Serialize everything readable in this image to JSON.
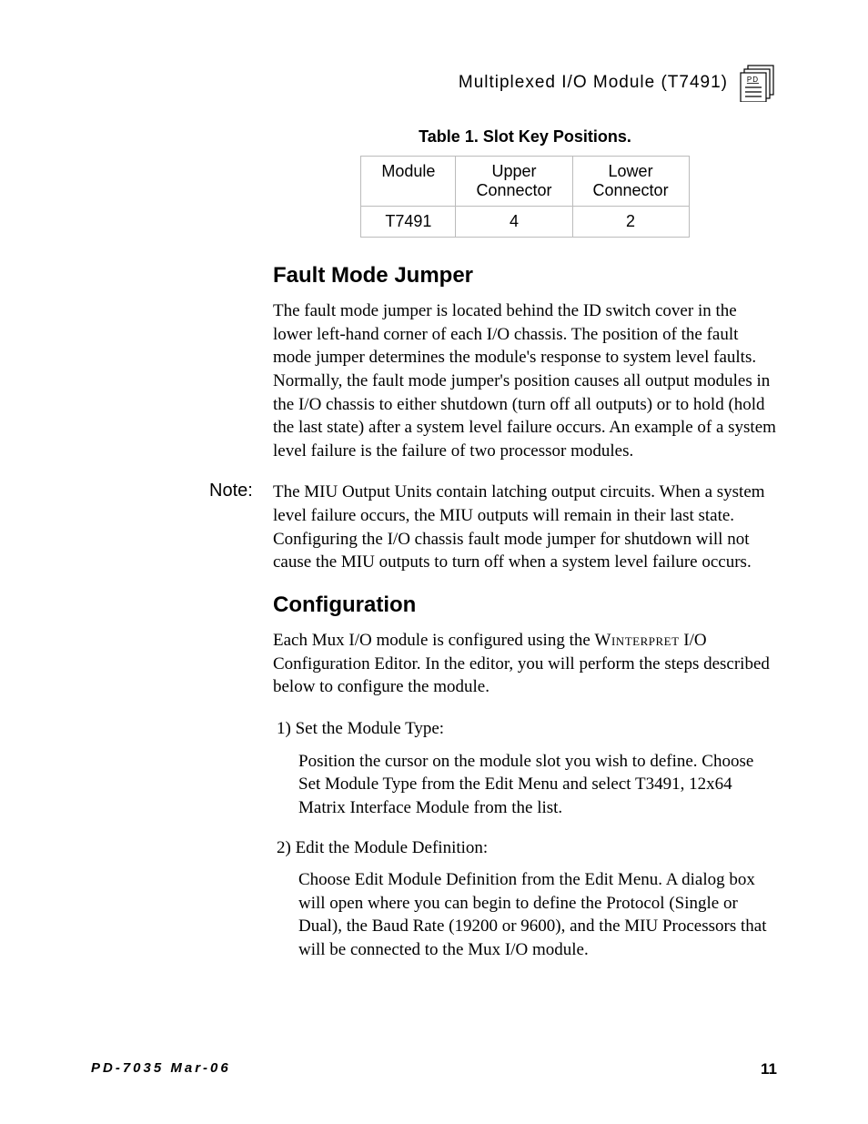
{
  "header": {
    "title": "Multiplexed  I/O  Module  (T7491)",
    "icon_name": "pd-document-icon"
  },
  "table": {
    "caption": "Table 1.  Slot Key Positions.",
    "headers": [
      "Module",
      "Upper Connector",
      "Lower Connector"
    ],
    "rows": [
      {
        "module": "T7491",
        "upper": "4",
        "lower": "2"
      }
    ]
  },
  "sections": {
    "fault": {
      "heading": "Fault Mode Jumper",
      "para": "The fault mode jumper is located behind the ID switch cover in the lower left-hand corner of each I/O chassis.  The position of the fault mode jumper determines the module's response to system level faults.  Normally, the fault mode jumper's position causes all output modules in the I/O chassis to either shutdown (turn off all outputs) or to hold (hold the last state) after a system level failure occurs.  An example of a system level failure is the failure of two processor modules."
    },
    "note": {
      "label": "Note:",
      "para": "The MIU Output Units contain latching output circuits.  When a system level failure occurs, the MIU outputs will remain in their last state.  Configuring the I/O chassis fault mode jumper for shutdown will not cause the MIU outputs to turn off when a system level failure occurs."
    },
    "config": {
      "heading": "Configuration",
      "intro_pre": "Each Mux I/O module is configured using the ",
      "intro_sc": "Winterpret",
      "intro_post": " I/O Configuration Editor.  In the editor, you will perform the steps described below to configure the module.",
      "steps": [
        {
          "head": "1) Set the Module Type:",
          "body": "Position the cursor on the module slot you wish to define.  Choose Set Module Type from the Edit Menu and select T3491, 12x64 Matrix Interface Module from the list."
        },
        {
          "head": "2) Edit the Module Definition:",
          "body": "Choose Edit Module Definition from the Edit Menu.  A dialog box will open where you can begin to define the Protocol (Single or Dual), the Baud Rate (19200 or 9600), and the MIU Processors that will be connected to the Mux I/O module."
        }
      ]
    }
  },
  "footer": {
    "left": "PD-7035  Mar-06",
    "right": "11"
  }
}
